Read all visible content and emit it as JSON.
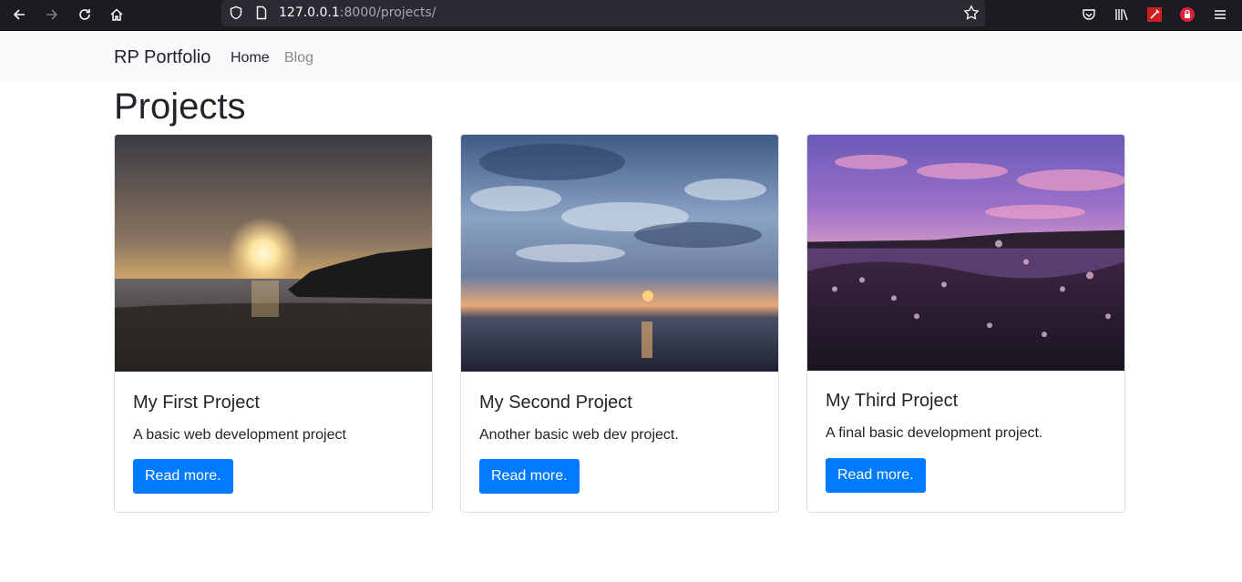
{
  "browser": {
    "url_host": "127.0.0.1",
    "url_rest": ":8000/projects/",
    "icons": [
      "back-arrow-icon",
      "forward-arrow-icon",
      "reload-icon",
      "home-icon",
      "shield-icon",
      "page-icon",
      "bookmark-star-icon",
      "pocket-icon",
      "library-icon",
      "extension-red-icon",
      "extension-lock-icon",
      "menu-icon"
    ]
  },
  "navbar": {
    "brand": "RP Portfolio",
    "links": [
      {
        "label": "Home"
      },
      {
        "label": "Blog"
      }
    ]
  },
  "page": {
    "title": "Projects"
  },
  "projects": [
    {
      "title": "My First Project",
      "description": "A basic web development project",
      "button": "Read more.",
      "image": "sunset-beach-silhouette"
    },
    {
      "title": "My Second Project",
      "description": "Another basic web dev project.",
      "button": "Read more.",
      "image": "cloudy-sunset-over-sea"
    },
    {
      "title": "My Third Project",
      "description": "A final basic development project.",
      "button": "Read more.",
      "image": "pink-sky-with-flowers"
    }
  ],
  "colors": {
    "primary": "#007bff",
    "navbar_bg": "#f8f9fa",
    "chrome_bg": "#1c1b22"
  }
}
